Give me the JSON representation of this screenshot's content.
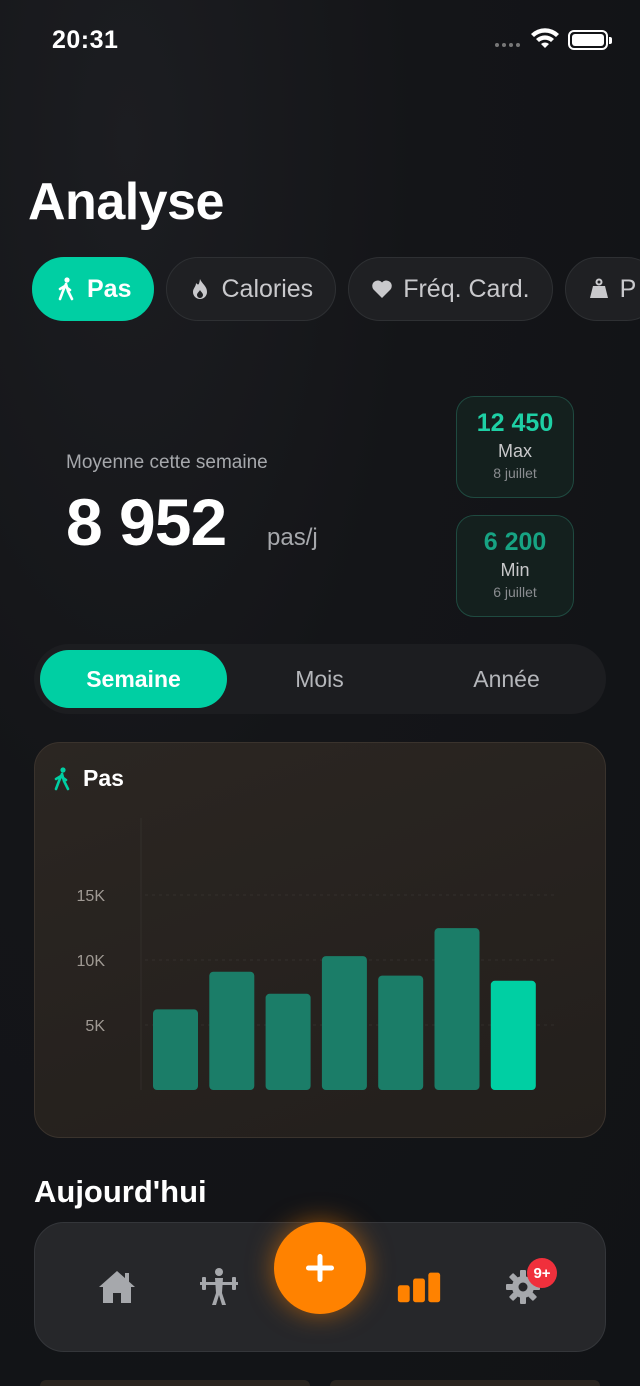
{
  "status": {
    "time": "20:31"
  },
  "page": {
    "title": "Analyse"
  },
  "metric_tabs": [
    {
      "label": "Pas",
      "icon": "walking-icon",
      "active": true
    },
    {
      "label": "Calories",
      "icon": "flame-icon",
      "active": false
    },
    {
      "label": "Fréq. Card.",
      "icon": "heart-icon",
      "active": false
    },
    {
      "label": "P",
      "icon": "weight-icon",
      "active": false
    }
  ],
  "summary": {
    "label": "Moyenne cette semaine",
    "value": "8 952",
    "unit": "pas/j"
  },
  "stats": {
    "max": {
      "value": "12 450",
      "label": "Max",
      "date": "8 juillet"
    },
    "min": {
      "value": "6 200",
      "label": "Min",
      "date": "6 juillet"
    }
  },
  "periods": [
    {
      "label": "Semaine",
      "active": true
    },
    {
      "label": "Mois",
      "active": false
    },
    {
      "label": "Année",
      "active": false
    }
  ],
  "chart_data": {
    "type": "bar",
    "title": "Pas",
    "categories": [
      "",
      "",
      "",
      "",
      "",
      "",
      ""
    ],
    "values": [
      6200,
      9100,
      7400,
      10300,
      8800,
      12450,
      8400
    ],
    "highlight_index": 6,
    "yticks": [
      {
        "label": "5K",
        "value": 5000
      },
      {
        "label": "10K",
        "value": 10000
      },
      {
        "label": "15K",
        "value": 15000
      }
    ],
    "ylim": [
      0,
      18000
    ],
    "grid": true
  },
  "section": {
    "title": "Aujourd'hui"
  },
  "tabbar": {
    "badge": "9+",
    "items": [
      "home-icon",
      "workout-icon",
      "add-icon",
      "analytics-icon",
      "settings-icon"
    ]
  },
  "colors": {
    "accent": "#00cfa3",
    "bar": "#1b7d68",
    "fab": "#ff8200",
    "analytics_active": "#ff8200",
    "badge": "#f0303c"
  }
}
